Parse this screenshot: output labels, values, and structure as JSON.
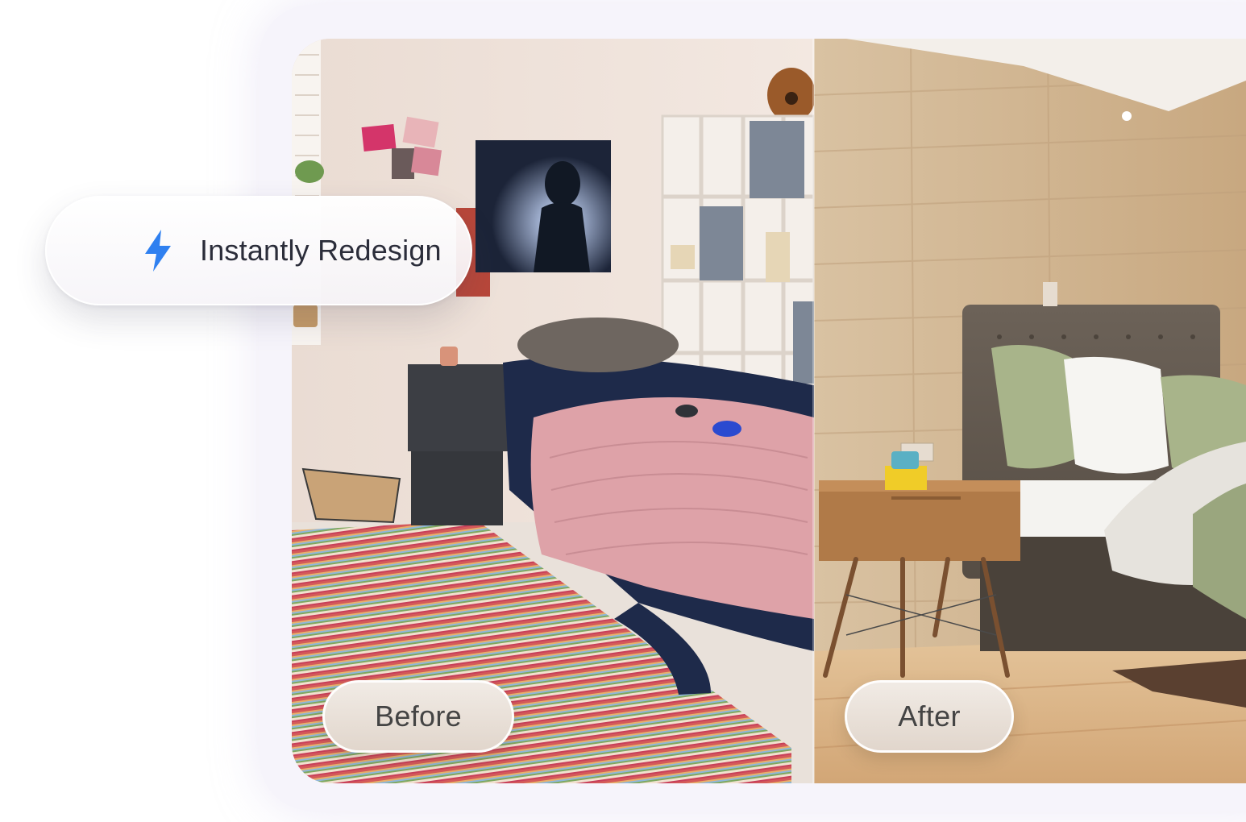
{
  "badge": {
    "label": "Instantly Redesign",
    "icon": "lightning-bolt-icon",
    "icon_color": "#2f80f0"
  },
  "comparison": {
    "before_label": "Before",
    "after_label": "After"
  },
  "colors": {
    "backdrop": "#f6f4fb",
    "pill_text": "#444444",
    "badge_text": "#2b2d3a"
  }
}
